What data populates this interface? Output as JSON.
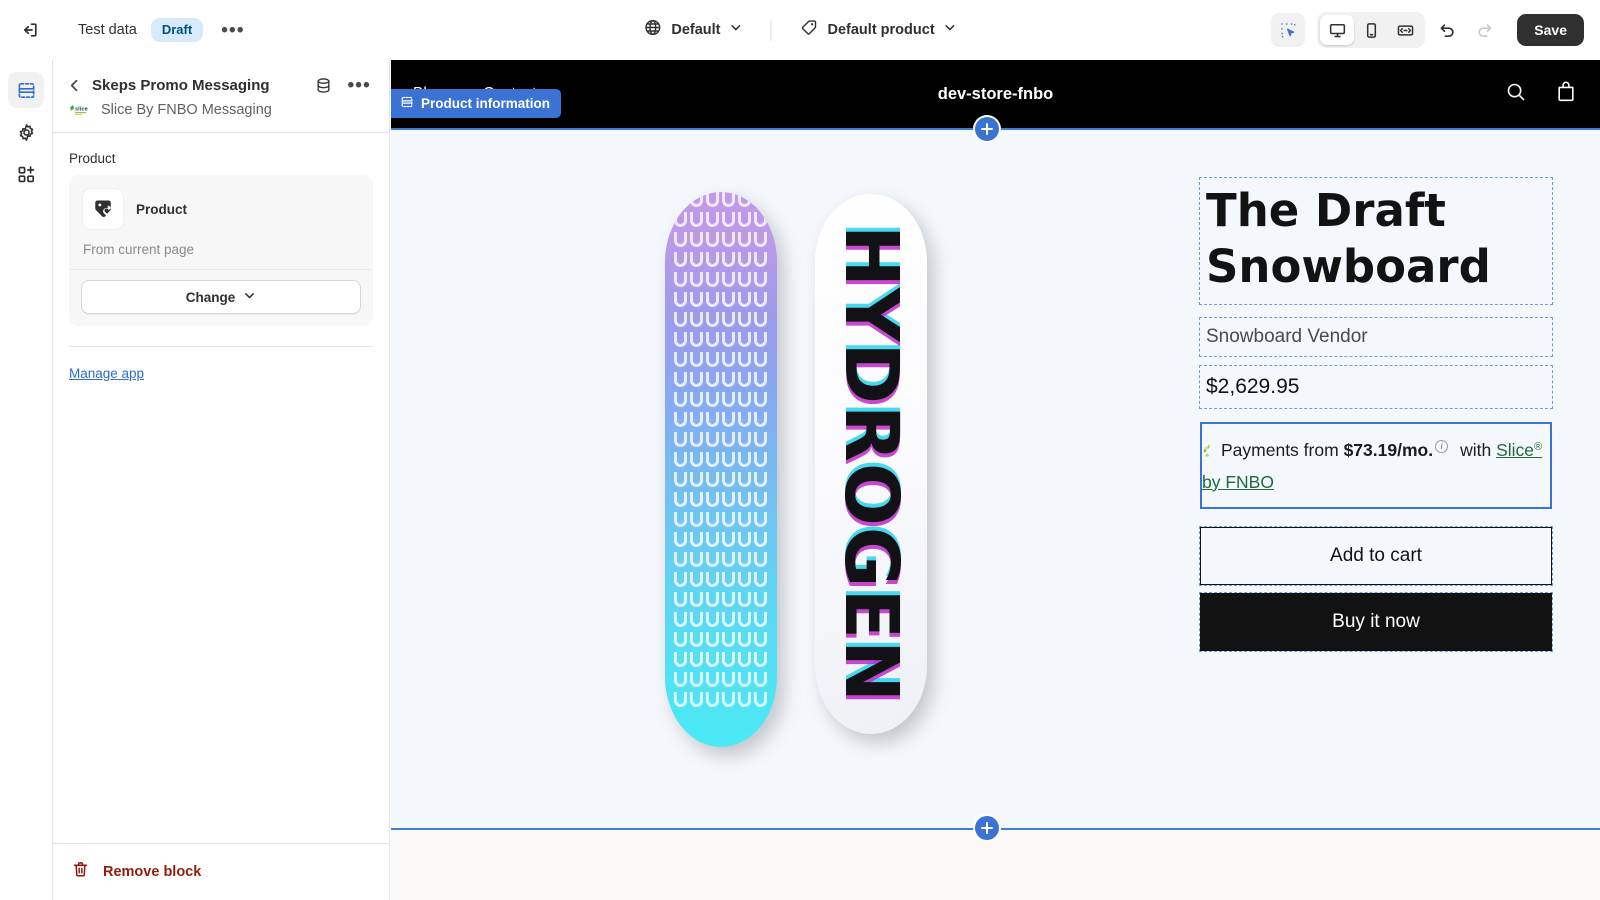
{
  "topbar": {
    "exit_icon": "exit-icon",
    "title": "Test data",
    "status_badge": "Draft",
    "more_menu": "•••",
    "theme_selector": {
      "icon": "globe-icon",
      "label": "Default",
      "caret": "chevron-down-icon"
    },
    "template_selector": {
      "icon": "tag-icon",
      "label": "Default product",
      "caret": "chevron-down-icon"
    },
    "inspect_icon": "inspect-select-icon",
    "devices": [
      {
        "name": "desktop",
        "icon": "desktop-icon",
        "active": true
      },
      {
        "name": "mobile",
        "icon": "mobile-icon",
        "active": false
      },
      {
        "name": "fullscreen",
        "icon": "fullscreen-icon",
        "active": false
      }
    ],
    "undo_icon": "undo-icon",
    "redo_icon": "redo-icon",
    "save_label": "Save"
  },
  "rail": {
    "items": [
      {
        "name": "sections",
        "icon": "sections-icon",
        "active": true
      },
      {
        "name": "theme-settings",
        "icon": "gear-icon",
        "active": false
      },
      {
        "name": "apps",
        "icon": "apps-add-icon",
        "active": false
      }
    ]
  },
  "sidebar": {
    "back_icon": "chevron-left-icon",
    "title": "Skeps Promo Messaging",
    "database_icon": "database-icon",
    "more_icon": "ellipsis-icon",
    "app_logo": "slice-logo",
    "app_name": "Slice By FNBO Messaging",
    "section_label": "Product",
    "product_card": {
      "icon": "product-tag-icon",
      "name": "Product",
      "source": "From current page",
      "change_label": "Change",
      "change_caret": "chevron-down-icon"
    },
    "manage_app_label": "Manage app",
    "footer": {
      "icon": "trash-icon",
      "label": "Remove block"
    }
  },
  "preview": {
    "section_badge": {
      "icon": "section-icon",
      "label": "Product information"
    },
    "store": {
      "nav_links": [
        "Blog",
        "Contact"
      ],
      "name": "dev-store-fnbo",
      "search_icon": "search-icon",
      "cart_icon": "shopping-bag-icon"
    },
    "add_section_top": "plus-icon",
    "add_section_bottom": "plus-icon",
    "gallery": {
      "board_left_alt": "purple-cyan-gradient-snowboard",
      "board_right_alt": "hydrogen-white-snowboard",
      "board_right_text": "HYDROGEN"
    },
    "product": {
      "title": "The Draft Snowboard",
      "vendor": "Snowboard Vendor",
      "price": "$2,629.95",
      "financing": {
        "leaf_icon": "slice-leaf-icon",
        "prefix": "Payments from",
        "amount": "$73.19/mo.",
        "info_icon": "info-icon",
        "with": "with",
        "brand": "Slice",
        "registered": "®",
        "brand_suffix": "by FNBO"
      },
      "add_to_cart_label": "Add to cart",
      "buy_now_label": "Buy it now"
    }
  },
  "colors": {
    "accent_blue": "#3b73d4",
    "link_blue": "#2c6ecb",
    "draft_badge_bg": "#d7eafc",
    "draft_badge_fg": "#00527c",
    "remove_red": "#8e1f0b",
    "save_dark": "#303030",
    "preview_bg": "#f4f8fd"
  }
}
